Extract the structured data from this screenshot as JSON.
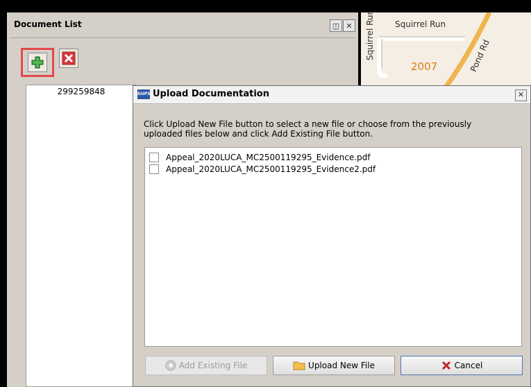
{
  "document_panel": {
    "title": "Document List",
    "add_button": "add-icon",
    "delete_button": "delete-icon",
    "list_items": [
      "299259848"
    ]
  },
  "map": {
    "labels": [
      "Squirrel Run",
      "Squirrel Run",
      "2007",
      "Pond Rd"
    ],
    "road_color": "#f0b44f",
    "label_color": "#e07c14"
  },
  "dialog": {
    "app_badge": "GUPS",
    "title": "Upload Documentation",
    "instructions": "Click Upload New File button to select a new file or choose from the previously uploaded files below and click Add Existing File button.",
    "files": [
      "Appeal_2020LUCA_MC2500119295_Evidence.pdf",
      "Appeal_2020LUCA_MC2500119295_Evidence2.pdf"
    ],
    "buttons": {
      "add_existing": "Add Existing File",
      "upload_new": "Upload New File",
      "cancel": "Cancel"
    }
  },
  "colors": {
    "title_bar": "#f2f2f2",
    "dialog_bg": "#d4d0c8",
    "highlight": "#e5484d",
    "cancel_border": "#4f74b0"
  }
}
